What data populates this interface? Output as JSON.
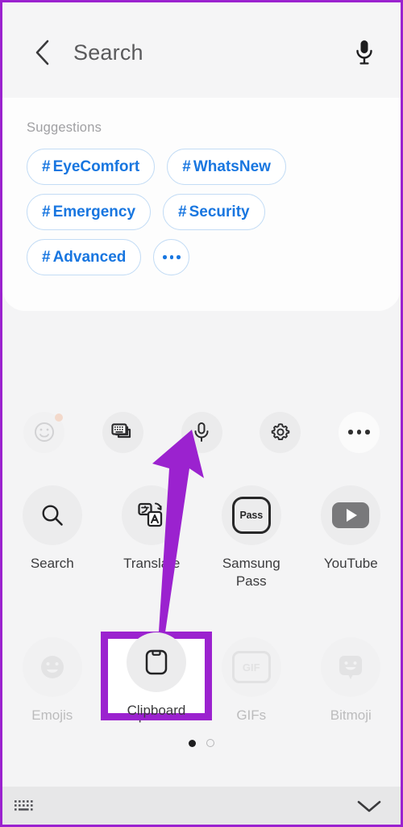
{
  "window": {
    "title": "Search",
    "annotation_color": "#9b22cf",
    "background": "#f4f4f5"
  },
  "header": {
    "back_icon": "chevron-left-icon",
    "title": "Search",
    "mic_icon": "microphone-icon"
  },
  "suggestions": {
    "label": "Suggestions",
    "more_label": "•••",
    "pills": [
      {
        "hash": "#",
        "text": "EyeComfort"
      },
      {
        "hash": "#",
        "text": "WhatsNew"
      },
      {
        "hash": "#",
        "text": "Emergency"
      },
      {
        "hash": "#",
        "text": "Security"
      },
      {
        "hash": "#",
        "text": "Advanced"
      }
    ],
    "border_color": "#c3dcf5",
    "text_color": "#1876e0"
  },
  "toolbar": {
    "items": [
      {
        "name": "emoji-icon",
        "label": "Emoji",
        "faded": true,
        "badge": true
      },
      {
        "name": "keyboard-layouts-icon",
        "label": "Keyboard layouts",
        "faded": false,
        "badge": false
      },
      {
        "name": "microphone-icon",
        "label": "Voice input",
        "faded": false,
        "badge": false
      },
      {
        "name": "gear-icon",
        "label": "Settings",
        "faded": false,
        "badge": false
      },
      {
        "name": "more-options-icon",
        "label": "More options",
        "faded": false,
        "badge": false
      }
    ]
  },
  "app_grid": {
    "rows": [
      [
        {
          "icon": "search-icon",
          "label": "Search",
          "faded": false
        },
        {
          "icon": "translate-icon",
          "label": "Translate",
          "faded": false
        },
        {
          "icon": "samsung-pass-icon",
          "label": "Samsung Pass",
          "icon_text": "Pass",
          "faded": false
        },
        {
          "icon": "youtube-icon",
          "label": "YouTube",
          "faded": false
        }
      ],
      [
        {
          "icon": "emojis-icon",
          "label": "Emojis",
          "faded": true
        },
        {
          "icon": "clipboard-icon",
          "label": "Clipboard",
          "faded": false,
          "highlighted": true
        },
        {
          "icon": "gif-icon",
          "label": "GIFs",
          "icon_text": "GIF",
          "faded": true
        },
        {
          "icon": "bitmoji-icon",
          "label": "Bitmoji",
          "faded": true
        }
      ]
    ]
  },
  "pagination": {
    "total": 2,
    "active_index": 0
  },
  "bottom_bar": {
    "keyboard_icon": "keyboard-icon",
    "collapse_icon": "chevron-down-icon"
  }
}
